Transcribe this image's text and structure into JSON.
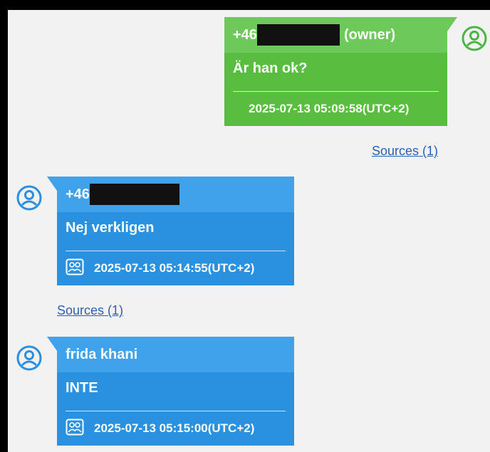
{
  "messages": [
    {
      "sender_prefix": "+46",
      "sender_suffix": "(owner)",
      "text": "Är han ok?",
      "timestamp": "2025-07-13 05:09:58(UTC+2)",
      "sources": "Sources (1)",
      "color": "#59bd40"
    },
    {
      "sender_prefix": "+46",
      "text": "Nej verkligen",
      "timestamp": "2025-07-13 05:14:55(UTC+2)",
      "sources": "Sources (1)",
      "color": "#2a90e0"
    },
    {
      "sender": "frida khani",
      "text": "INTE",
      "timestamp": "2025-07-13 05:15:00(UTC+2)",
      "color": "#2a90e0"
    }
  ]
}
